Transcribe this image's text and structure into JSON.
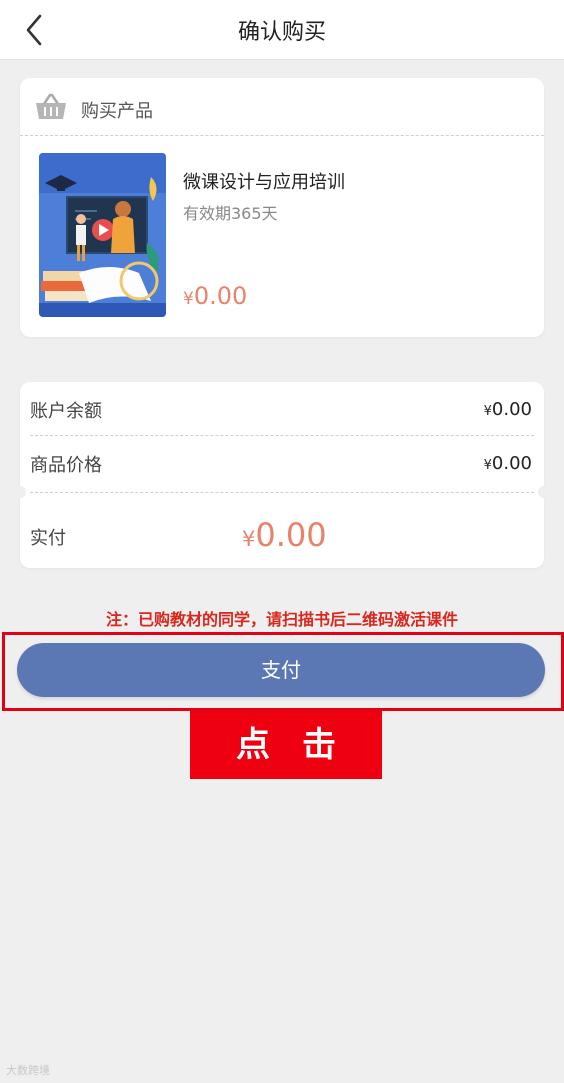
{
  "nav": {
    "title": "确认购买",
    "back_icon": "chevron-left-icon"
  },
  "product_card": {
    "header_label": "购买产品",
    "header_icon": "basket-icon",
    "name": "微课设计与应用培训",
    "validity": "有效期365天",
    "price_symbol": "¥",
    "price": "0.00"
  },
  "summary": {
    "balance_label": "账户余额",
    "balance_symbol": "¥",
    "balance_value": "0.00",
    "price_label": "商品价格",
    "price_symbol": "¥",
    "price_value": "0.00",
    "paid_label": "实付",
    "paid_symbol": "¥",
    "paid_value": "0.00"
  },
  "note": "注：已购教材的同学，请扫描书后二维码激活课件",
  "pay_button": "支付",
  "click_annotation": "点击",
  "watermark": "大数跨境",
  "colors": {
    "accent_price": "#e8836b",
    "pay_button": "#5b77b4",
    "note_red": "#d8281e",
    "annotation_red": "#ee0010"
  }
}
